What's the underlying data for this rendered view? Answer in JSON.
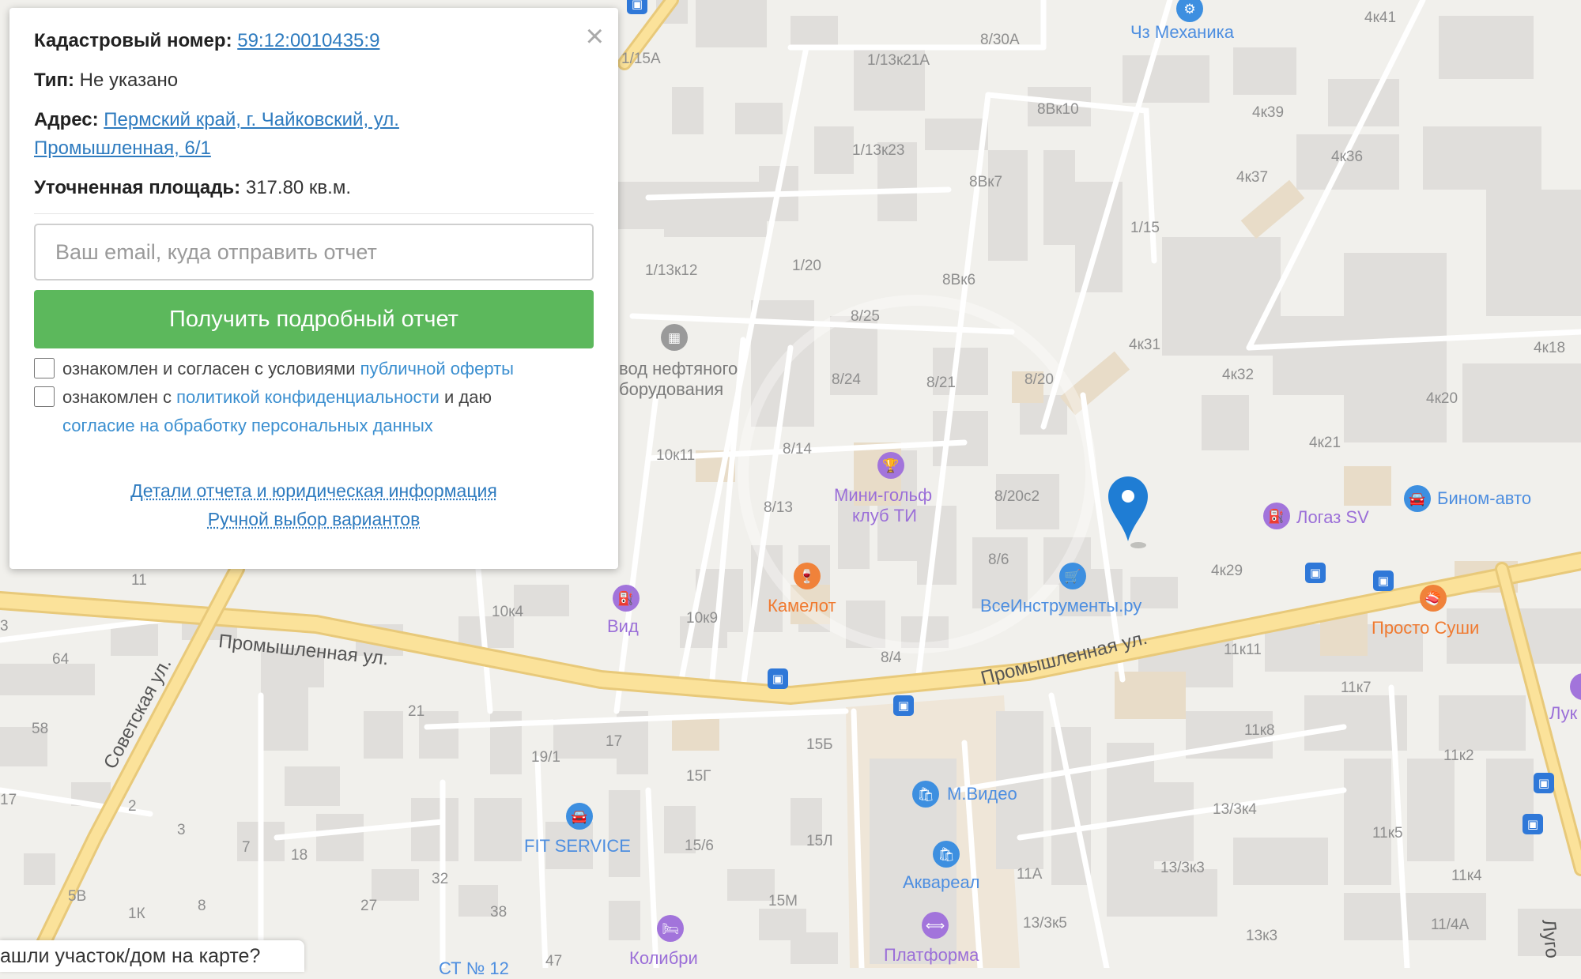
{
  "popup": {
    "close_label": "×",
    "cadastral_label": "Кадастровый номер:",
    "cadastral_value": "59:12:0010435:9",
    "type_label": "Тип:",
    "type_value": "Не указано",
    "address_label": "Адрес:",
    "address_line1": "Пермский край, г. Чайковский, ул.",
    "address_line2": "Промышленная, 6/1",
    "area_label": "Уточненная площадь:",
    "area_value": "317.80 кв.м.",
    "email_placeholder": "Ваш email, куда отправить отчет",
    "report_button": "Получить подробный отчет",
    "consent1_prefix": "ознакомлен и согласен с условиями ",
    "consent1_link": "публичной оферты",
    "consent2_prefix": "ознакомлен с ",
    "consent2_link1": "политикой конфиденциальности",
    "consent2_middle": " и даю",
    "consent2_link2": "согласие на обработку персональных данных",
    "details_link": "Детали отчета и юридическая информация",
    "manual_link": "Ручной выбор вариантов"
  },
  "bottom_tab": "ашли участок/дом на карте?",
  "map": {
    "streets": {
      "promyshlennaya_left": "Промышленная ул.",
      "promyshlennaya_right": "Промышленная ул.",
      "sovetskaya": "Советская ул.",
      "lugovaya": "Луго"
    },
    "pois": {
      "mechanika": "Чз Механика",
      "zavod": "вод нефтяного",
      "zavod2": "борудования",
      "minigolf": "Мини-гольф",
      "minigolf2": "клуб ТИ",
      "logaz": "Логаз SV",
      "binom": "Бином-авто",
      "kamelot": "Камелот",
      "vid": "Вид",
      "vseinstr": "ВсеИнструменты.ру",
      "prostosushi": "Просто Суши",
      "mvideo": "М.Видео",
      "akvareal": "Аквареал",
      "platforma": "Платформа",
      "fitservice": "FIT SERVICE",
      "kolibri": "Колибри",
      "luk": "Лук",
      "st": "СТ № 12"
    },
    "houses": {
      "h1": "8/30А",
      "h2": "1/13к21А",
      "h3": "1/15А",
      "h4": "4к41",
      "h5": "8Вк10",
      "h6": "4к39",
      "h7": "1/13к23",
      "h8": "4к36",
      "h9": "8Вк7",
      "h10": "4к37",
      "h11": "1/15",
      "h12": "1/13к12",
      "h13": "1/20",
      "h14": "8Вк6",
      "h15": "8/25",
      "h16": "4к31",
      "h17": "4к18",
      "h18": "8/24",
      "h19": "8/21",
      "h20": "8/20",
      "h21": "4к32",
      "h22": "4к20",
      "h23": "4к21",
      "h24": "10к11",
      "h25": "8/14",
      "h26": "8/20с2",
      "h27": "8/13",
      "h28": "8/6",
      "h29": "4к29",
      "h30": "10к4",
      "h31": "10к9",
      "h32": "8/4",
      "h33": "11к11",
      "h34": "11к7",
      "h35": "11",
      "h36": "64",
      "h37": "58",
      "h38": "21",
      "h39": "19/1",
      "h40": "17",
      "h41": "15Б",
      "h42": "15Г",
      "h43": "11к8",
      "h44": "11к2",
      "h45": "17",
      "h46": "3",
      "h47": "2",
      "h48": "7",
      "h49": "18",
      "h50": "15/6",
      "h51": "15Л",
      "h52": "13/3к4",
      "h53": "11к5",
      "h54": "13/3к3",
      "h55": "11А",
      "h56": "11к4",
      "h57": "5В",
      "h58": "1К",
      "h59": "8",
      "h60": "27",
      "h61": "32",
      "h62": "38",
      "h63": "15М",
      "h64": "13/3к5",
      "h65": "13к3",
      "h66": "11/4А",
      "h67": "47",
      "h68": "3"
    }
  },
  "colors": {
    "map_bg": "#f1f0ec",
    "building": "#e2e0dc",
    "road_main": "#fbe29a",
    "button_green": "#5cb85c",
    "link_blue": "#2e7bbf",
    "pin_blue": "#1f7dd4"
  }
}
